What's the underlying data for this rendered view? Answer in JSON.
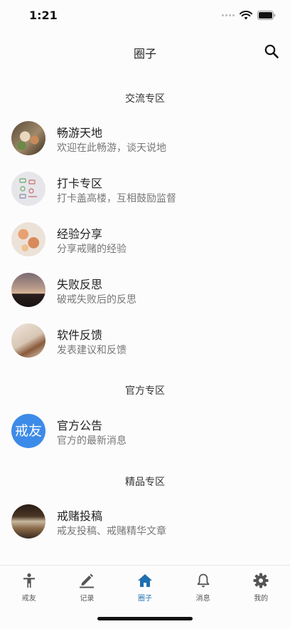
{
  "status": {
    "time": "1:21"
  },
  "nav": {
    "title": "圈子"
  },
  "sections": [
    {
      "title": "交流专区",
      "items": [
        {
          "title": "畅游天地",
          "subtitle": "欢迎在此畅游，谈天说地",
          "icon": "food-photo"
        },
        {
          "title": "打卡专区",
          "subtitle": "打卡盖高楼，互相鼓励监督",
          "icon": "checklist-photo"
        },
        {
          "title": "经验分享",
          "subtitle": "分享戒赌的经验",
          "icon": "pizza-photo"
        },
        {
          "title": "失败反思",
          "subtitle": "破戒失败后的反思",
          "icon": "sunset-photo"
        },
        {
          "title": "软件反馈",
          "subtitle": "发表建议和反馈",
          "icon": "writing-photo"
        }
      ]
    },
    {
      "title": "官方专区",
      "items": [
        {
          "title": "官方公告",
          "subtitle": "官方的最新消息",
          "avatar_text": "戒友",
          "color": "#3d8be8"
        }
      ]
    },
    {
      "title": "精品专区",
      "items": [
        {
          "title": "戒赌投稿",
          "subtitle": "戒友投稿、戒赌精华文章",
          "icon": "books-photo"
        }
      ]
    }
  ],
  "tabs": [
    {
      "label": "戒友",
      "icon": "person-icon"
    },
    {
      "label": "记录",
      "icon": "pencil-icon"
    },
    {
      "label": "圈子",
      "icon": "home-icon",
      "active": true
    },
    {
      "label": "消息",
      "icon": "bell-icon"
    },
    {
      "label": "我的",
      "icon": "gear-icon"
    }
  ],
  "colors": {
    "accent": "#1e6fb0",
    "official_avatar": "#3d8be8"
  }
}
